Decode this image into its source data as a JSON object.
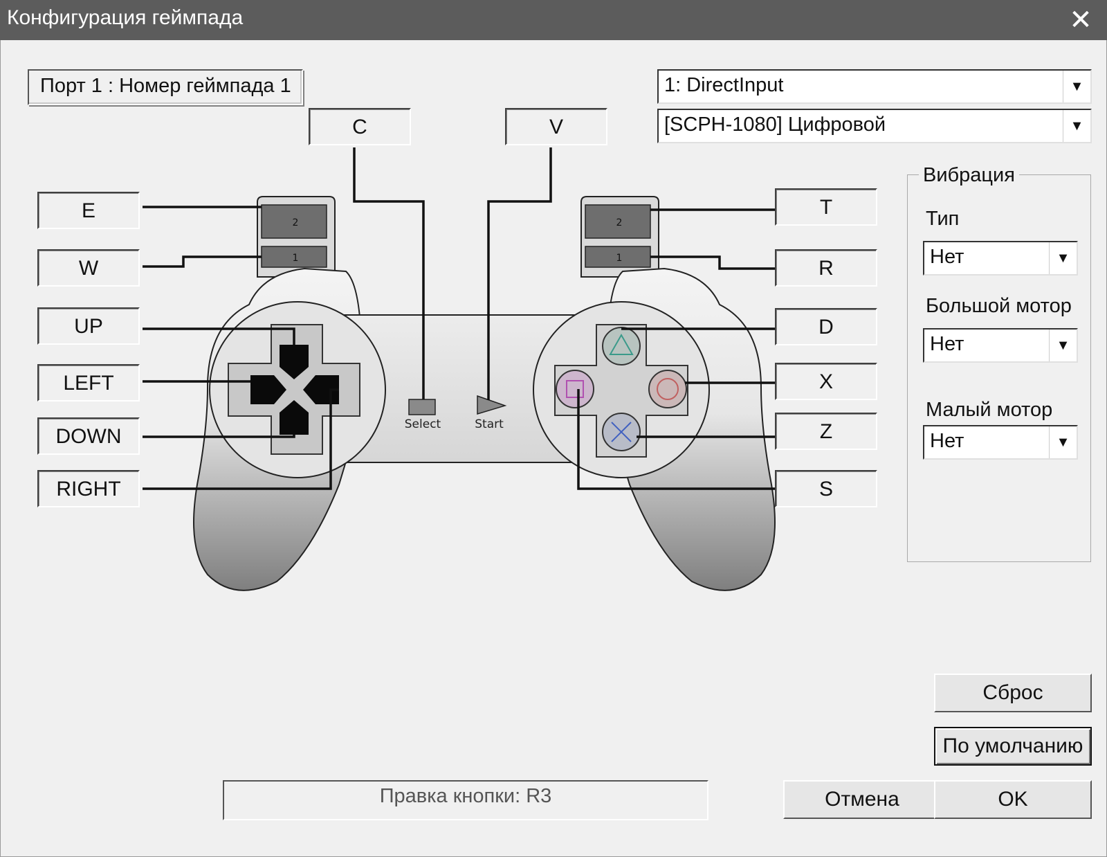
{
  "window": {
    "title": "Конфигурация геймпада"
  },
  "port_label": "Порт 1 : Номер геймпада 1",
  "device_select": {
    "value": "1: DirectInput"
  },
  "controller_select": {
    "value": "[SCPH-1080] Цифровой"
  },
  "bindings": {
    "l2": "E",
    "l1": "W",
    "up": "UP",
    "left": "LEFT",
    "down": "DOWN",
    "right": "RIGHT",
    "select": "C",
    "start": "V",
    "r2": "T",
    "r1": "R",
    "triangle": "D",
    "circle": "X",
    "cross": "Z",
    "square": "S"
  },
  "pad_labels": {
    "select": "Select",
    "start": "Start",
    "l2": "2",
    "l1": "1",
    "r2": "2",
    "r1": "1"
  },
  "vibration": {
    "title": "Вибрация",
    "type_label": "Тип",
    "type_value": "Нет",
    "large_label": "Большой мотор",
    "large_value": "Нет",
    "small_label": "Малый мотор",
    "small_value": "Нет"
  },
  "buttons": {
    "reset": "Сброс",
    "defaults": "По умолчанию",
    "cancel": "Отмена",
    "ok": "OK"
  },
  "status_text": "Правка кнопки: R3",
  "colors": {
    "titlebar": "#5c5c5c",
    "triangle": "#3a9a8a",
    "circle": "#c06060",
    "cross": "#4060c0",
    "square": "#b050b0"
  }
}
